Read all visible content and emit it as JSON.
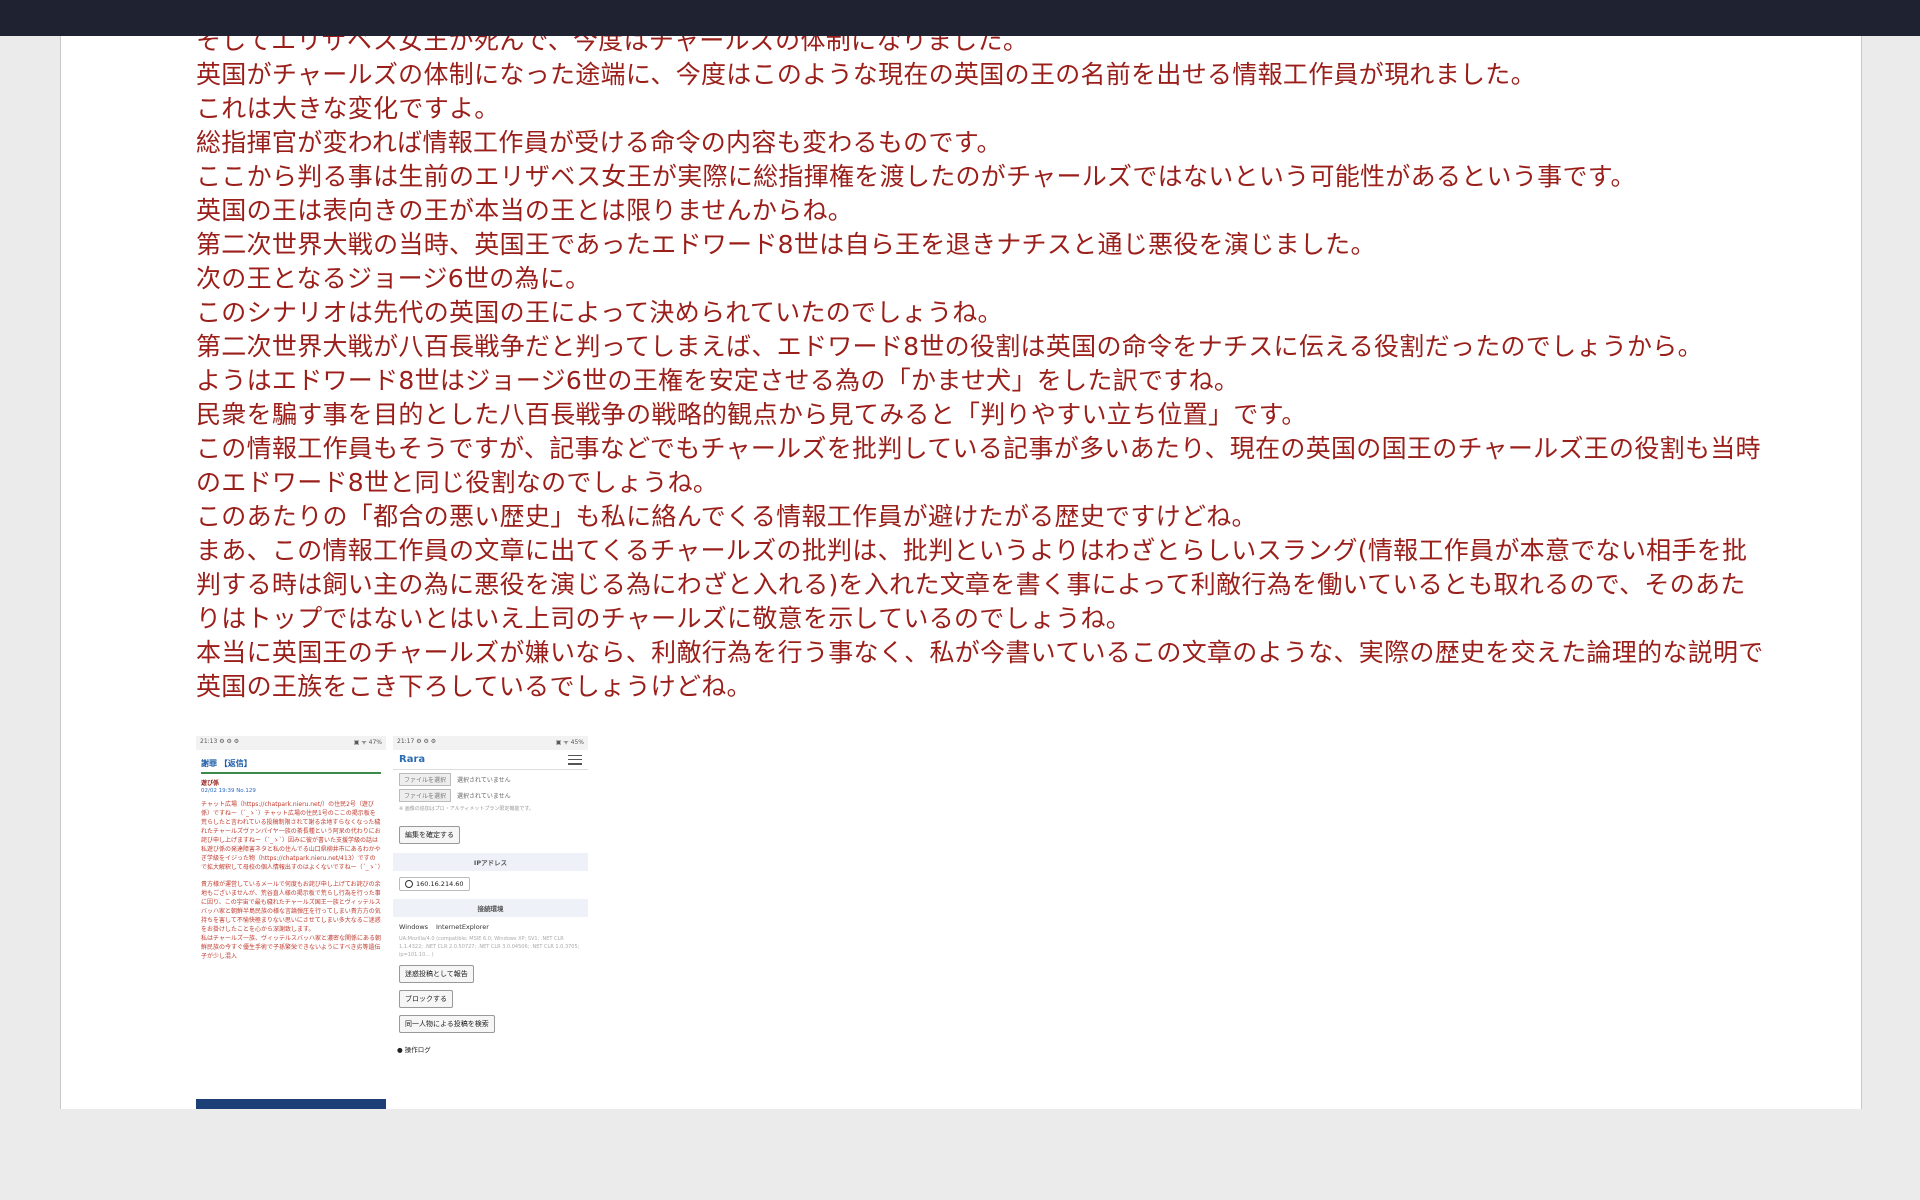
{
  "article": {
    "lines": [
      "そしてエリザベス女王が死んで、今度はチャールズの体制になりました。",
      "英国がチャールズの体制になった途端に、今度はこのような現在の英国の王の名前を出せる情報工作員が現れました。",
      "これは大きな変化ですよ。",
      "総指揮官が変われば情報工作員が受ける命令の内容も変わるものです。",
      "ここから判る事は生前のエリザベス女王が実際に総指揮権を渡したのがチャールズではないという可能性があるという事です。",
      "英国の王は表向きの王が本当の王とは限りませんからね。",
      "第二次世界大戦の当時、英国王であったエドワード8世は自ら王を退きナチスと通じ悪役を演じました。",
      "次の王となるジョージ6世の為に。",
      "このシナリオは先代の英国の王によって決められていたのでしょうね。",
      "第二次世界大戦が八百長戦争だと判ってしまえば、エドワード8世の役割は英国の命令をナチスに伝える役割だったのでしょうから。",
      "ようはエドワード8世はジョージ6世の王権を安定させる為の「かませ犬」をした訳ですね。",
      "民衆を騙す事を目的とした八百長戦争の戦略的観点から見てみると「判りやすい立ち位置」です。",
      "この情報工作員もそうですが、記事などでもチャールズを批判している記事が多いあたり、現在の英国の国王のチャールズ王の役割も当時のエドワード8世と同じ役割なのでしょうね。",
      "このあたりの「都合の悪い歴史」も私に絡んでくる情報工作員が避けたがる歴史ですけどね。",
      "まあ、この情報工作員の文章に出てくるチャールズの批判は、批判というよりはわざとらしいスラング(情報工作員が本意でない相手を批判する時は飼い主の為に悪役を演じる為にわざと入れる)を入れた文章を書く事によって利敵行為を働いているとも取れるので、そのあたりはトップではないとはいえ上司のチャールズに敬意を示しているのでしょうね。",
      "本当に英国王のチャールズが嫌いなら、利敵行為を行う事なく、私が今書いているこの文章のような、実際の歴史を交えた論理的な説明で英国の王族をこき下ろしているでしょうけどね。"
    ]
  },
  "screenshot1": {
    "status_time": "21:13 ⚙ ⚙ ⚙",
    "status_right": "▣ ᯤ 47%",
    "title": "謝罪 【返信】",
    "author": "遊び係",
    "date": "02/02 19:39 No.129",
    "body": "チャット広場（https://chatpark.nieru.net/）の住民2号（遊び係）ですねー（´_ゝ`）チャット広場の住民1号のここの掲示板を荒らしたと言われている投稿制限されて謝る余地すらなくなった穢れたチャールズヴァンパイヤ一族の茶長種という阿呆の代わりにお詫び申し上げますねー（´_ゝ`）因みに彼が書いた支援学級の話は私遊び係の発達障害ネタと私の住んでる山口県柳井市にあるわかやぎ学級をイジった物（https://chatpark.nieru.net/413）ですので拡大解釈して母校の個人情報出すのはよくないですねー（´_ゝ`）",
    "body2": "貴方様が運営しているメールで何度もお詫び申し上げてお詫びの余地もございませんが、荒谷直人様の掲示板で荒らし行為を行った事に因り、この宇宙で最も穢れたチャールズ国王一族とヴィッテルスバッハ家と朝鮮半島民族の様な言論弾圧を行ってしまい貴方方の気持ちを害して不愉快極まりない思いにさせてしまい多大なるご迷惑をお掛けしたことを心から深謝致します。\n私はチャールズ一族、ヴィッテルスバッハ家と濃密な関係にある朝鮮民族の今すぐ優生手術で子孫繁栄できないようにすべき劣等遺伝子が少し混入"
  },
  "screenshot2": {
    "status_time": "21:17 ⚙ ⚙ ⚙",
    "status_right": "▣ ᯤ 45%",
    "logo": "Rara",
    "file_button": "ファイルを選択",
    "file_status": "選択されていません",
    "note": "※ 画像の追加はプロ・アルティメットプラン限定機能です。",
    "confirm_button": "編集を確定する",
    "ip_section": "IPアドレス",
    "ip_value": "160.16.214.60",
    "env_section": "接続環境",
    "os": "Windows",
    "browser": "InternetExplorer",
    "ua_text": "UA:Mozilla/4.0 (compatible; MSIE 6.0; Windows XP; SV1; .NET CLR 1.1.4322; .NET CLR 2.0.50727; .NET CLR 3.0.04506; .NET CLR 1.0.3705; ip=101.10... )",
    "report_button": "迷惑投稿として報告",
    "block_button": "ブロックする",
    "search_button": "同一人物による投稿を検索",
    "log_label": "操作ログ"
  },
  "colors": {
    "text": "#9a1f1a",
    "topbar": "#1f2230",
    "background": "#ebebeb"
  }
}
